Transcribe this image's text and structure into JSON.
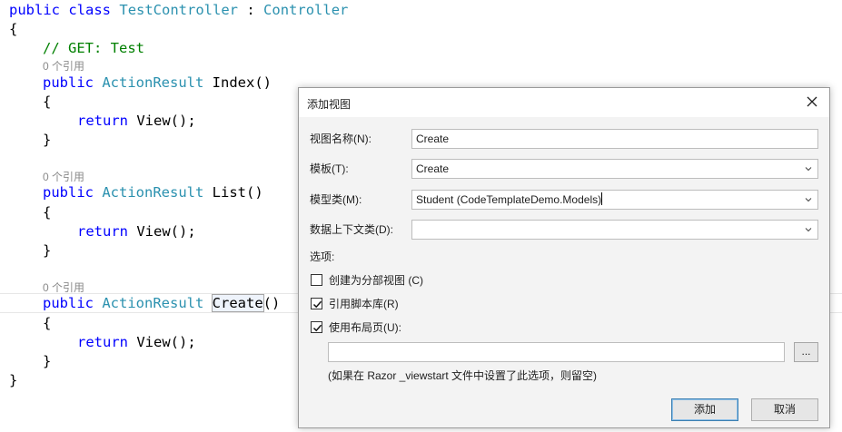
{
  "code": {
    "l1": {
      "kw1": "public",
      "kw2": "class",
      "name": "TestController",
      "sep": ":",
      "base": "Controller"
    },
    "open_brace": "{",
    "close_brace": "}",
    "comment": "// GET: Test",
    "ref_lens": "0 个引用",
    "methods": [
      {
        "kw": "public",
        "type": "ActionResult",
        "name": "Index",
        "parens": "()",
        "ret": "return",
        "call": "View();"
      },
      {
        "kw": "public",
        "type": "ActionResult",
        "name": "List",
        "parens": "()",
        "ret": "return",
        "call": "View();"
      },
      {
        "kw": "public",
        "type": "ActionResult",
        "name": "Create",
        "parens": "()",
        "ret": "return",
        "call": "View();"
      }
    ]
  },
  "dialog": {
    "title": "添加视图",
    "close_icon": "close-icon",
    "view_name": {
      "label": "视图名称(N):",
      "value": "Create"
    },
    "template": {
      "label": "模板(T):",
      "value": "Create"
    },
    "model_class": {
      "label": "模型类(M):",
      "value": "Student (CodeTemplateDemo.Models)"
    },
    "data_context": {
      "label": "数据上下文类(D):",
      "value": ""
    },
    "options_label": "选项:",
    "options": [
      {
        "label": "创建为分部视图 (C)",
        "checked": false
      },
      {
        "label": "引用脚本库(R)",
        "checked": true
      },
      {
        "label": "使用布局页(U):",
        "checked": true
      }
    ],
    "layout_path": "",
    "browse_label": "...",
    "hint": "(如果在 Razor _viewstart 文件中设置了此选项，则留空)",
    "add_button": "添加",
    "cancel_button": "取消"
  }
}
